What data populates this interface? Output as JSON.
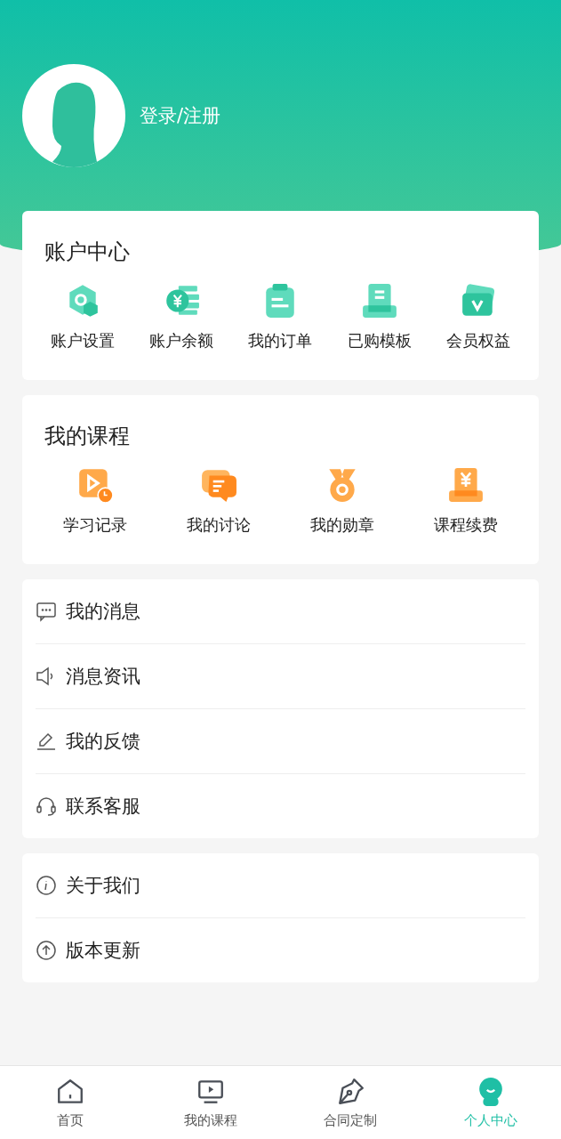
{
  "header": {
    "login_text": "登录/注册"
  },
  "account_center": {
    "title": "账户中心",
    "items": [
      {
        "kind": "settings",
        "label": "账户设置"
      },
      {
        "kind": "balance",
        "label": "账户余额"
      },
      {
        "kind": "orders",
        "label": "我的订单"
      },
      {
        "kind": "templates",
        "label": "已购模板"
      },
      {
        "kind": "vip",
        "label": "会员权益"
      }
    ]
  },
  "my_courses": {
    "title": "我的课程",
    "items": [
      {
        "kind": "history",
        "label": "学习记录"
      },
      {
        "kind": "discussion",
        "label": "我的讨论"
      },
      {
        "kind": "medal",
        "label": "我的勋章"
      },
      {
        "kind": "renew",
        "label": "课程续费"
      }
    ]
  },
  "menu_groups": [
    [
      {
        "kind": "message",
        "label": "我的消息"
      },
      {
        "kind": "news",
        "label": "消息资讯"
      },
      {
        "kind": "feedback",
        "label": "我的反馈"
      },
      {
        "kind": "service",
        "label": "联系客服"
      }
    ],
    [
      {
        "kind": "about",
        "label": "关于我们"
      },
      {
        "kind": "update",
        "label": "版本更新"
      }
    ]
  ],
  "tabs": [
    {
      "kind": "home",
      "label": "首页",
      "selected": false
    },
    {
      "kind": "courses",
      "label": "我的课程",
      "selected": false
    },
    {
      "kind": "contract",
      "label": "合同定制",
      "selected": false
    },
    {
      "kind": "profile",
      "label": "个人中心",
      "selected": true
    }
  ]
}
